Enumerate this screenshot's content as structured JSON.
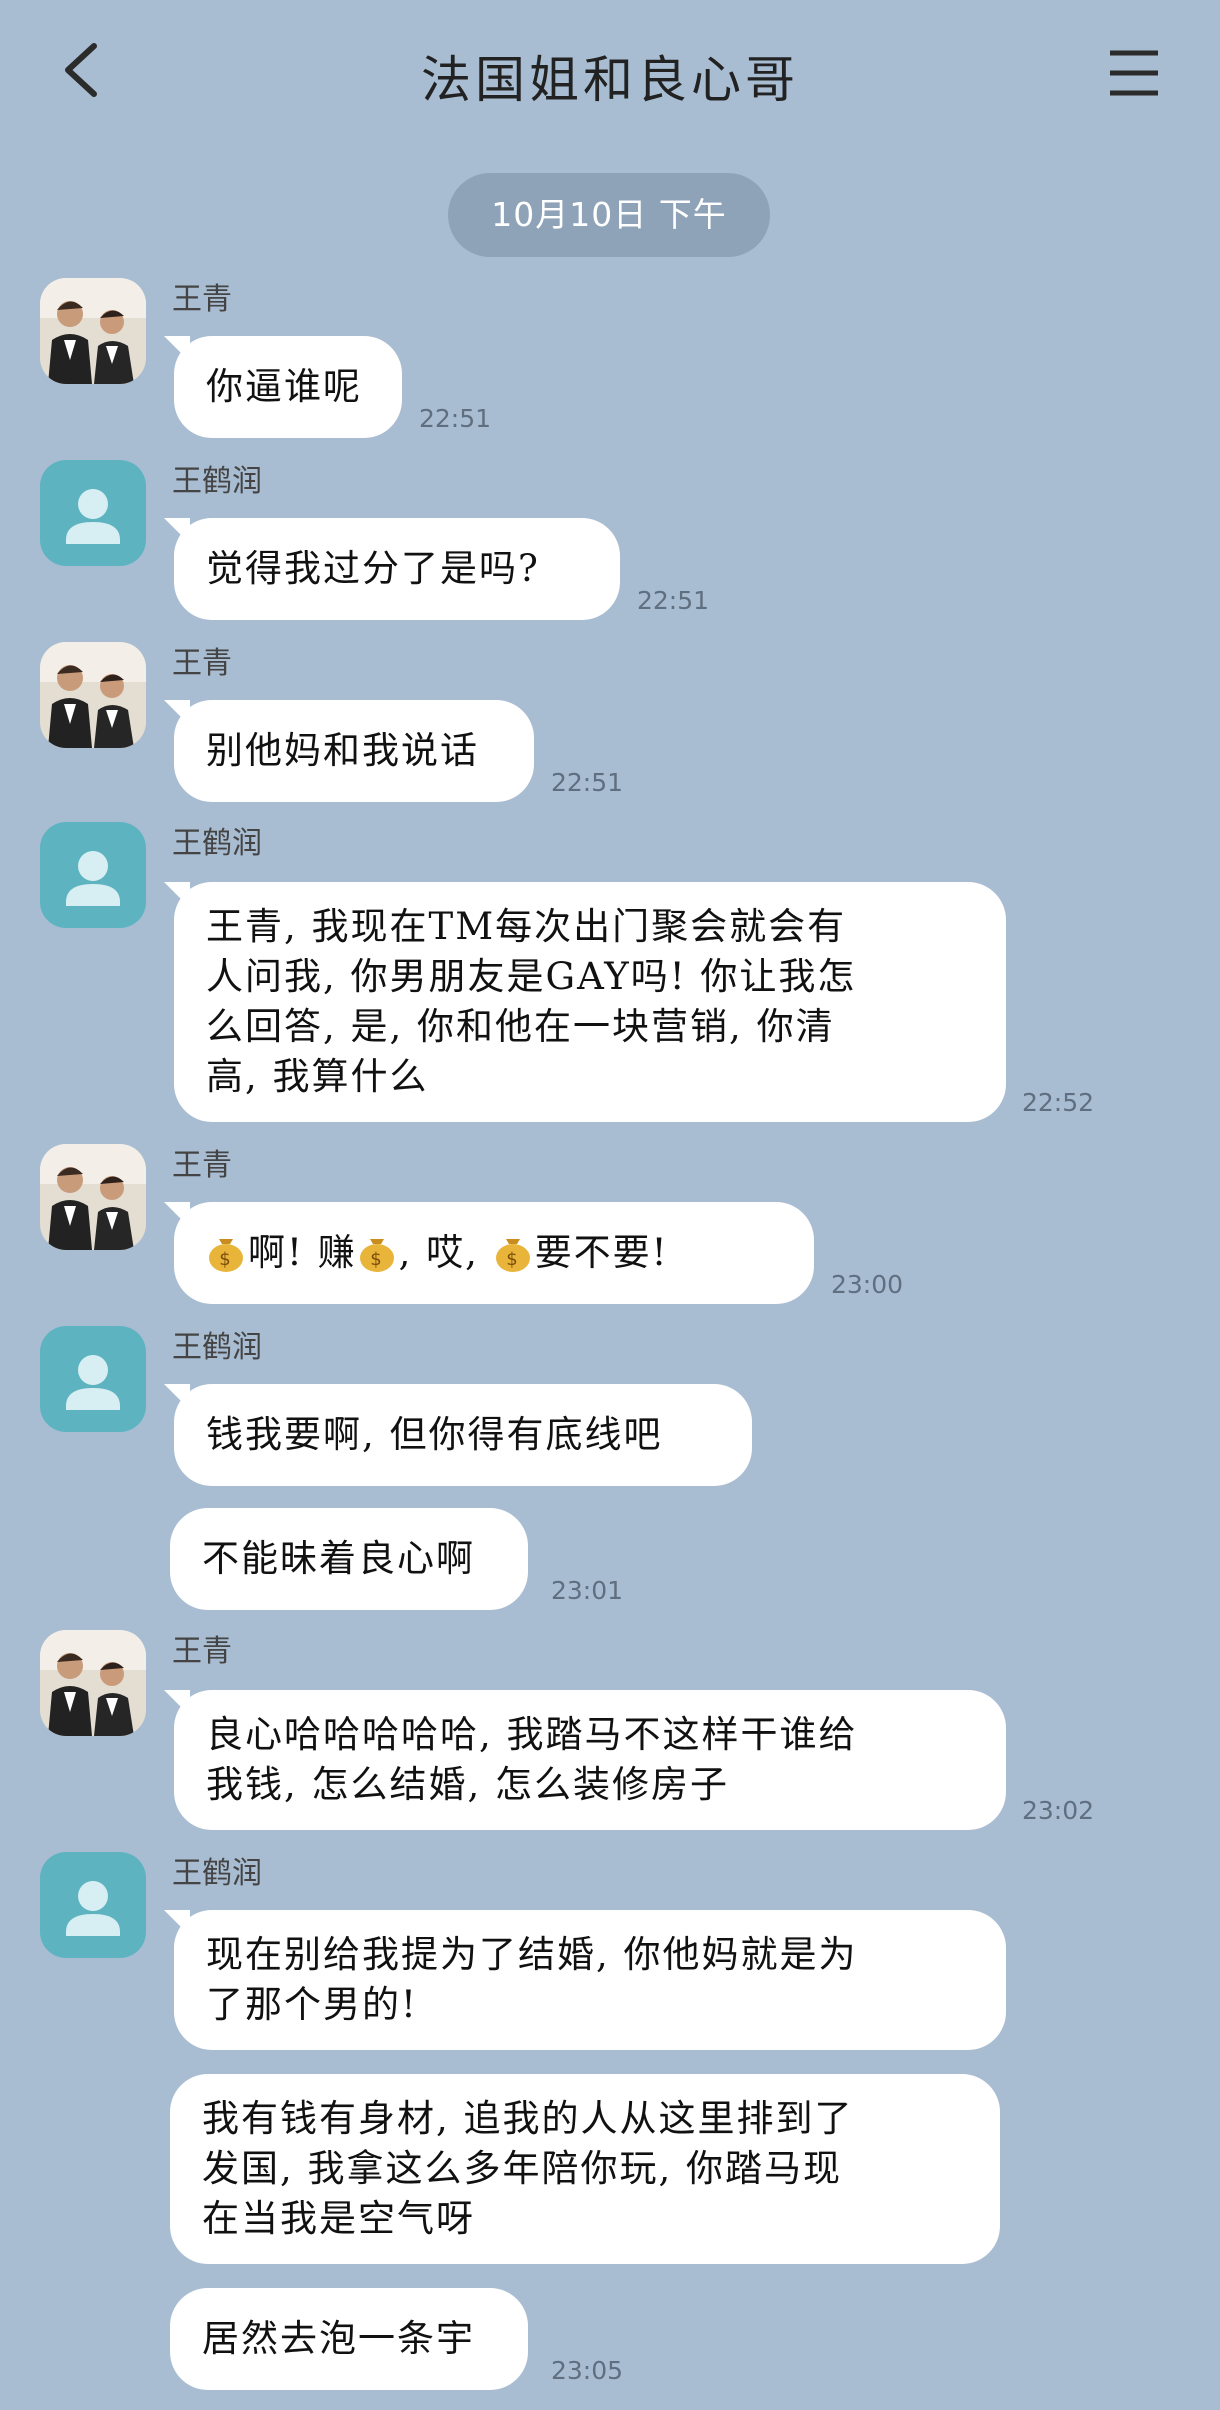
{
  "header": {
    "title": "法国姐和良心哥",
    "back_icon": "chevron-left-icon",
    "menu_icon": "hamburger-menu-icon"
  },
  "date_divider": "10月10日 下午",
  "senders": {
    "a": "王青",
    "b": "王鹤润"
  },
  "colors": {
    "background": "#a9bdd2",
    "bubble": "#ffffff",
    "default_avatar": "#5eb3c0",
    "date_pill": "#8fa3b8"
  },
  "messages": [
    {
      "sender": "王青",
      "text": "你逼谁呢",
      "time": "22:51"
    },
    {
      "sender": "王鹤润",
      "text": "觉得我过分了是吗?",
      "time": "22:51"
    },
    {
      "sender": "王青",
      "text": "别他妈和我说话",
      "time": "22:51"
    },
    {
      "sender": "王鹤润",
      "text": "王青, 我现在TM每次出门聚会就会有\n人问我, 你男朋友是GAY吗! 你让我怎\n么回答, 是, 你和他在一块营销, 你清\n高, 我算什么",
      "time": "22:52"
    },
    {
      "sender": "王青",
      "parts": [
        "啊! 赚",
        ", 哎, ",
        "要不要!"
      ],
      "time": "23:00"
    },
    {
      "sender": "王鹤润",
      "text": "钱我要啊, 但你得有底线吧"
    },
    {
      "sender": "王鹤润",
      "text": "不能昧着良心啊",
      "time": "23:01"
    },
    {
      "sender": "王青",
      "text": "良心哈哈哈哈哈, 我踏马不这样干谁给\n我钱, 怎么结婚, 怎么装修房子",
      "time": "23:02"
    },
    {
      "sender": "王鹤润",
      "text": "现在别给我提为了结婚, 你他妈就是为\n了那个男的!"
    },
    {
      "sender": "王鹤润",
      "text": "我有钱有身材, 追我的人从这里排到了\n发国, 我拿这么多年陪你玩, 你踏马现\n在当我是空气呀"
    },
    {
      "sender": "王鹤润",
      "text": "居然去泡一条宇",
      "time": "23:05"
    }
  ]
}
